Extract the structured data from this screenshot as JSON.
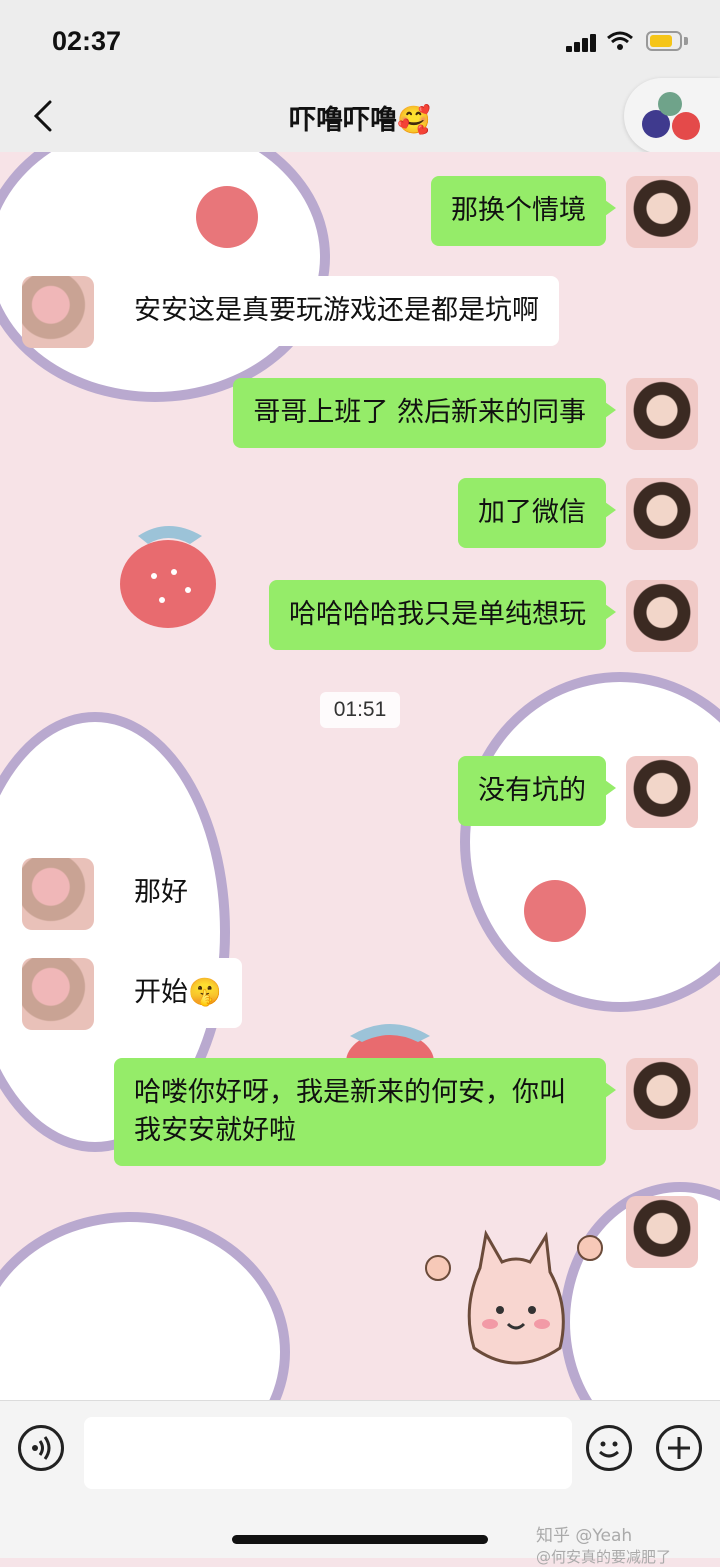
{
  "status_bar": {
    "time": "02:37"
  },
  "navbar": {
    "title": "吓噜吓噜🥰",
    "back_icon": "chevron-left-icon"
  },
  "messages": [
    {
      "side": "right",
      "text": "那换个情境"
    },
    {
      "side": "left",
      "text": "安安这是真要玩游戏还是都是坑啊"
    },
    {
      "side": "right",
      "text": "哥哥上班了 然后新来的同事"
    },
    {
      "side": "right",
      "text": "加了微信"
    },
    {
      "side": "right",
      "text": "哈哈哈哈我只是单纯想玩"
    },
    {
      "side": "right",
      "text": "没有坑的"
    },
    {
      "side": "left",
      "text": "那好"
    },
    {
      "side": "left",
      "text": "开始🤫"
    },
    {
      "side": "right",
      "text": "哈喽你好呀，我是新来的何安，你叫我安安就好啦"
    }
  ],
  "timestamp": "01:51",
  "input_bar": {
    "voice_icon": "voice-icon",
    "emoji_icon": "emoji-icon",
    "plus_icon": "plus-icon"
  },
  "watermark": "知乎 @Yeah",
  "watermark2": "@何安真的要减肥了",
  "colors": {
    "bubble_green": "#95ec69",
    "bubble_white": "#ffffff",
    "bar_bg": "#ededed"
  }
}
